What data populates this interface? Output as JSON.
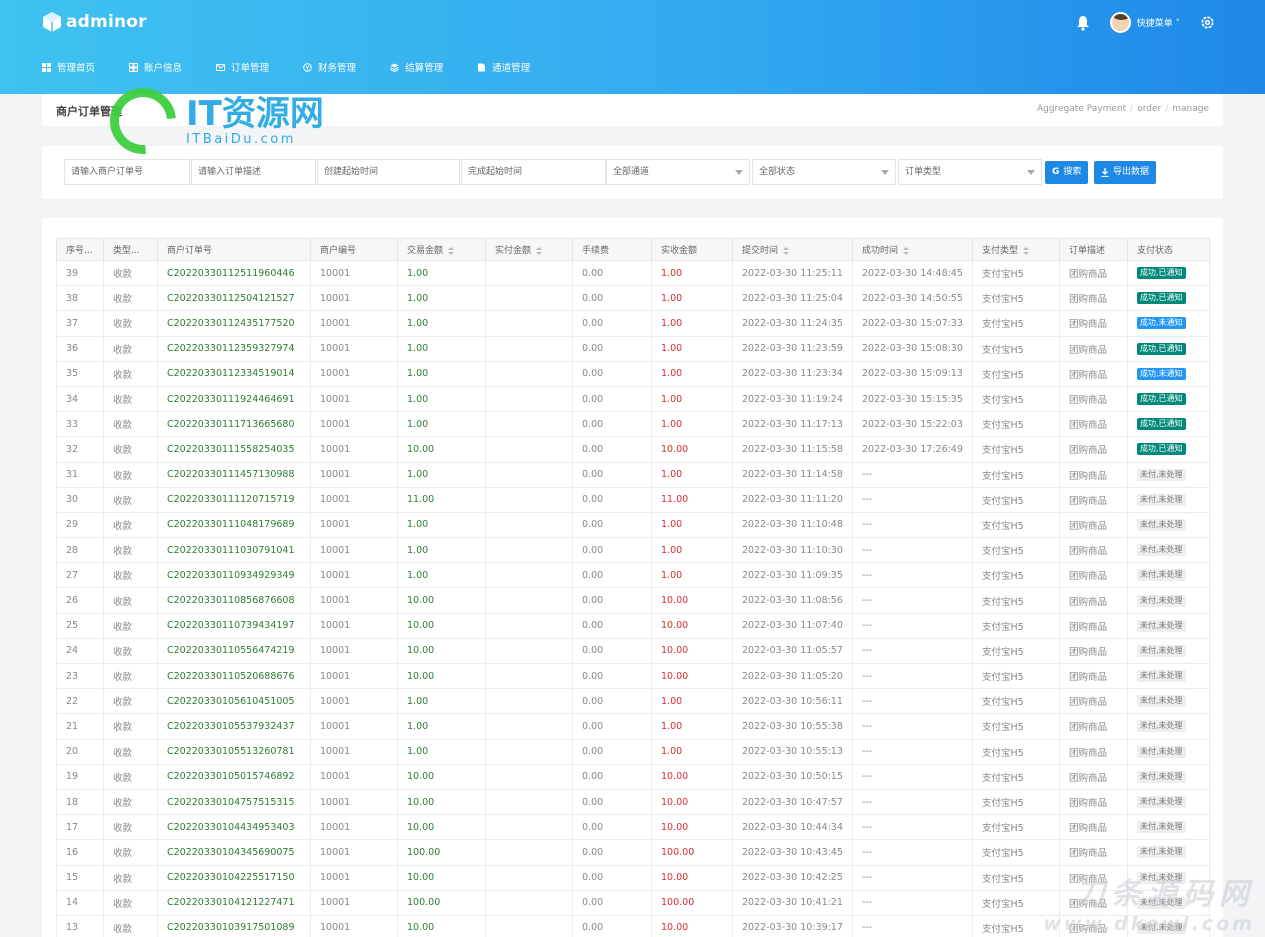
{
  "app": {
    "name": "adminor"
  },
  "header": {
    "user_label": "快捷菜单 ˅"
  },
  "nav": [
    {
      "label": "管理首页",
      "icon": "dashboard-icon"
    },
    {
      "label": "账户信息",
      "icon": "grid-icon"
    },
    {
      "label": "订单管理",
      "icon": "mail-icon"
    },
    {
      "label": "财务管理",
      "icon": "finance-icon"
    },
    {
      "label": "结算管理",
      "icon": "layers-icon"
    },
    {
      "label": "通道管理",
      "icon": "document-icon"
    }
  ],
  "page": {
    "title": "商户订单管理",
    "breadcrumb": [
      "Aggregate Payment",
      "order",
      "manage"
    ]
  },
  "filters": {
    "merchant_order_placeholder": "请输入商户订单号",
    "order_desc_placeholder": "请输入订单描述",
    "created_start_placeholder": "创建起始时间",
    "finished_start_placeholder": "完成起始时间",
    "channel_select": "全部通道",
    "status_select": "全部状态",
    "type_select": "订单类型",
    "search_button": "搜索",
    "export_button": "导出数据"
  },
  "table": {
    "columns": [
      "序号...",
      "类型...",
      "商户订单号",
      "商户编号",
      "交易金额",
      "实付金额",
      "手续费",
      "实收金额",
      "提交时间",
      "成功时间",
      "支付类型",
      "订单描述",
      "支付状态"
    ],
    "rows": [
      {
        "id": "39",
        "type": "收款",
        "order_no": "C2022033011251196044​6",
        "merchant": "10001",
        "amount": "1.00",
        "paid": "",
        "fee": "0.00",
        "received": "1.00",
        "submit_time": "2022-03-30 11:25:11",
        "success_time": "2022-03-30 14:48:45",
        "pay_type": "支付宝H5",
        "desc": "团购商品",
        "status": "成功,已通知",
        "status_kind": "ok"
      },
      {
        "id": "38",
        "type": "收款",
        "order_no": "C2022033011250412152​7",
        "merchant": "10001",
        "amount": "1.00",
        "paid": "",
        "fee": "0.00",
        "received": "1.00",
        "submit_time": "2022-03-30 11:25:04",
        "success_time": "2022-03-30 14:50:55",
        "pay_type": "支付宝H5",
        "desc": "团购商品",
        "status": "成功,已通知",
        "status_kind": "ok"
      },
      {
        "id": "37",
        "type": "收款",
        "order_no": "C202203301124351775​20",
        "merchant": "10001",
        "amount": "1.00",
        "paid": "",
        "fee": "0.00",
        "received": "1.00",
        "submit_time": "2022-03-30 11:24:35",
        "success_time": "2022-03-30 15:07:33",
        "pay_type": "支付宝H5",
        "desc": "团购商品",
        "status": "成功,未通知",
        "status_kind": "info"
      },
      {
        "id": "36",
        "type": "收款",
        "order_no": "C2022033011235932797​4",
        "merchant": "10001",
        "amount": "1.00",
        "paid": "",
        "fee": "0.00",
        "received": "1.00",
        "submit_time": "2022-03-30 11:23:59",
        "success_time": "2022-03-30 15:08:30",
        "pay_type": "支付宝H5",
        "desc": "团购商品",
        "status": "成功,已通知",
        "status_kind": "ok"
      },
      {
        "id": "35",
        "type": "收款",
        "order_no": "C2022033011233451901​4",
        "merchant": "10001",
        "amount": "1.00",
        "paid": "",
        "fee": "0.00",
        "received": "1.00",
        "submit_time": "2022-03-30 11:23:34",
        "success_time": "2022-03-30 15:09:13",
        "pay_type": "支付宝H5",
        "desc": "团购商品",
        "status": "成功,未通知",
        "status_kind": "info"
      },
      {
        "id": "34",
        "type": "收款",
        "order_no": "C2022033011192446469​1",
        "merchant": "10001",
        "amount": "1.00",
        "paid": "",
        "fee": "0.00",
        "received": "1.00",
        "submit_time": "2022-03-30 11:19:24",
        "success_time": "2022-03-30 15:15:35",
        "pay_type": "支付宝H5",
        "desc": "团购商品",
        "status": "成功,已通知",
        "status_kind": "ok"
      },
      {
        "id": "33",
        "type": "收款",
        "order_no": "C2022033011171366568​0",
        "merchant": "10001",
        "amount": "1.00",
        "paid": "",
        "fee": "0.00",
        "received": "1.00",
        "submit_time": "2022-03-30 11:17:13",
        "success_time": "2022-03-30 15:22:03",
        "pay_type": "支付宝H5",
        "desc": "团购商品",
        "status": "成功,已通知",
        "status_kind": "ok"
      },
      {
        "id": "32",
        "type": "收款",
        "order_no": "C2022033011155825403​5",
        "merchant": "10001",
        "amount": "10.00",
        "paid": "",
        "fee": "0.00",
        "received": "10.00",
        "submit_time": "2022-03-30 11:15:58",
        "success_time": "2022-03-30 17:26:49",
        "pay_type": "支付宝H5",
        "desc": "团购商品",
        "status": "成功,已通知",
        "status_kind": "ok"
      },
      {
        "id": "31",
        "type": "收款",
        "order_no": "C2022033011145713098​8",
        "merchant": "10001",
        "amount": "1.00",
        "paid": "",
        "fee": "0.00",
        "received": "1.00",
        "submit_time": "2022-03-30 11:14:58",
        "success_time": "---",
        "pay_type": "支付宝H5",
        "desc": "团购商品",
        "status": "未付,未处理",
        "status_kind": "pend"
      },
      {
        "id": "30",
        "type": "收款",
        "order_no": "C2022033011112071571​9",
        "merchant": "10001",
        "amount": "11.00",
        "paid": "",
        "fee": "0.00",
        "received": "11.00",
        "submit_time": "2022-03-30 11:11:20",
        "success_time": "---",
        "pay_type": "支付宝H5",
        "desc": "团购商品",
        "status": "未付,未处理",
        "status_kind": "pend"
      },
      {
        "id": "29",
        "type": "收款",
        "order_no": "C2022033011104817968​9",
        "merchant": "10001",
        "amount": "1.00",
        "paid": "",
        "fee": "0.00",
        "received": "1.00",
        "submit_time": "2022-03-30 11:10:48",
        "success_time": "---",
        "pay_type": "支付宝H5",
        "desc": "团购商品",
        "status": "未付,未处理",
        "status_kind": "pend"
      },
      {
        "id": "28",
        "type": "收款",
        "order_no": "C2022033011103079104​1",
        "merchant": "10001",
        "amount": "1.00",
        "paid": "",
        "fee": "0.00",
        "received": "1.00",
        "submit_time": "2022-03-30 11:10:30",
        "success_time": "---",
        "pay_type": "支付宝H5",
        "desc": "团购商品",
        "status": "未付,未处理",
        "status_kind": "pend"
      },
      {
        "id": "27",
        "type": "收款",
        "order_no": "C2022033011093492934​9",
        "merchant": "10001",
        "amount": "1.00",
        "paid": "",
        "fee": "0.00",
        "received": "1.00",
        "submit_time": "2022-03-30 11:09:35",
        "success_time": "---",
        "pay_type": "支付宝H5",
        "desc": "团购商品",
        "status": "未付,未处理",
        "status_kind": "pend"
      },
      {
        "id": "26",
        "type": "收款",
        "order_no": "C2022033011085687660​8",
        "merchant": "10001",
        "amount": "10.00",
        "paid": "",
        "fee": "0.00",
        "received": "10.00",
        "submit_time": "2022-03-30 11:08:56",
        "success_time": "---",
        "pay_type": "支付宝H5",
        "desc": "团购商品",
        "status": "未付,未处理",
        "status_kind": "pend"
      },
      {
        "id": "25",
        "type": "收款",
        "order_no": "C2022033011073943419​7",
        "merchant": "10001",
        "amount": "10.00",
        "paid": "",
        "fee": "0.00",
        "received": "10.00",
        "submit_time": "2022-03-30 11:07:40",
        "success_time": "---",
        "pay_type": "支付宝H5",
        "desc": "团购商品",
        "status": "未付,未处理",
        "status_kind": "pend"
      },
      {
        "id": "24",
        "type": "收款",
        "order_no": "C2022033011055647421​9",
        "merchant": "10001",
        "amount": "10.00",
        "paid": "",
        "fee": "0.00",
        "received": "10.00",
        "submit_time": "2022-03-30 11:05:57",
        "success_time": "---",
        "pay_type": "支付宝H5",
        "desc": "团购商品",
        "status": "未付,未处理",
        "status_kind": "pend"
      },
      {
        "id": "23",
        "type": "收款",
        "order_no": "C2022033011052068867​6",
        "merchant": "10001",
        "amount": "10.00",
        "paid": "",
        "fee": "0.00",
        "received": "10.00",
        "submit_time": "2022-03-30 11:05:20",
        "success_time": "---",
        "pay_type": "支付宝H5",
        "desc": "团购商品",
        "status": "未付,未处理",
        "status_kind": "pend"
      },
      {
        "id": "22",
        "type": "收款",
        "order_no": "C2022033010561045100​5",
        "merchant": "10001",
        "amount": "1.00",
        "paid": "",
        "fee": "0.00",
        "received": "1.00",
        "submit_time": "2022-03-30 10:56:11",
        "success_time": "---",
        "pay_type": "支付宝H5",
        "desc": "团购商品",
        "status": "未付,未处理",
        "status_kind": "pend"
      },
      {
        "id": "21",
        "type": "收款",
        "order_no": "C2022033010553793243​7",
        "merchant": "10001",
        "amount": "1.00",
        "paid": "",
        "fee": "0.00",
        "received": "1.00",
        "submit_time": "2022-03-30 10:55:38",
        "success_time": "---",
        "pay_type": "支付宝H5",
        "desc": "团购商品",
        "status": "未付,未处理",
        "status_kind": "pend"
      },
      {
        "id": "20",
        "type": "收款",
        "order_no": "C2022033010551326078​1",
        "merchant": "10001",
        "amount": "1.00",
        "paid": "",
        "fee": "0.00",
        "received": "1.00",
        "submit_time": "2022-03-30 10:55:13",
        "success_time": "---",
        "pay_type": "支付宝H5",
        "desc": "团购商品",
        "status": "未付,未处理",
        "status_kind": "pend"
      },
      {
        "id": "19",
        "type": "收款",
        "order_no": "C2022033010501574689​2",
        "merchant": "10001",
        "amount": "10.00",
        "paid": "",
        "fee": "0.00",
        "received": "10.00",
        "submit_time": "2022-03-30 10:50:15",
        "success_time": "---",
        "pay_type": "支付宝H5",
        "desc": "团购商品",
        "status": "未付,未处理",
        "status_kind": "pend"
      },
      {
        "id": "18",
        "type": "收款",
        "order_no": "C2022033010475751531​5",
        "merchant": "10001",
        "amount": "10.00",
        "paid": "",
        "fee": "0.00",
        "received": "10.00",
        "submit_time": "2022-03-30 10:47:57",
        "success_time": "---",
        "pay_type": "支付宝H5",
        "desc": "团购商品",
        "status": "未付,未处理",
        "status_kind": "pend"
      },
      {
        "id": "17",
        "type": "收款",
        "order_no": "C2022033010443495340​3",
        "merchant": "10001",
        "amount": "10.00",
        "paid": "",
        "fee": "0.00",
        "received": "10.00",
        "submit_time": "2022-03-30 10:44:34",
        "success_time": "---",
        "pay_type": "支付宝H5",
        "desc": "团购商品",
        "status": "未付,未处理",
        "status_kind": "pend"
      },
      {
        "id": "16",
        "type": "收款",
        "order_no": "C2022033010434569007​5",
        "merchant": "10001",
        "amount": "100.00",
        "paid": "",
        "fee": "0.00",
        "received": "100.00",
        "submit_time": "2022-03-30 10:43:45",
        "success_time": "---",
        "pay_type": "支付宝H5",
        "desc": "团购商品",
        "status": "未付,未处理",
        "status_kind": "pend"
      },
      {
        "id": "15",
        "type": "收款",
        "order_no": "C2022033010422551715​0",
        "merchant": "10001",
        "amount": "10.00",
        "paid": "",
        "fee": "0.00",
        "received": "10.00",
        "submit_time": "2022-03-30 10:42:25",
        "success_time": "---",
        "pay_type": "支付宝H5",
        "desc": "团购商品",
        "status": "未付,未处理",
        "status_kind": "pend"
      },
      {
        "id": "14",
        "type": "收款",
        "order_no": "C2022033010412122747​1",
        "merchant": "10001",
        "amount": "100.00",
        "paid": "",
        "fee": "0.00",
        "received": "100.00",
        "submit_time": "2022-03-30 10:41:21",
        "success_time": "---",
        "pay_type": "支付宝H5",
        "desc": "团购商品",
        "status": "未付,未处理",
        "status_kind": "pend"
      },
      {
        "id": "13",
        "type": "收款",
        "order_no": "C2022033010391750108​9",
        "merchant": "10001",
        "amount": "10.00",
        "paid": "",
        "fee": "0.00",
        "received": "10.00",
        "submit_time": "2022-03-30 10:39:17",
        "success_time": "---",
        "pay_type": "支付宝H5",
        "desc": "团购商品",
        "status": "未付,未处理",
        "status_kind": "pend"
      }
    ]
  },
  "watermarks": {
    "main_title": "IT资源网",
    "main_sub": "ITBaiDu.com",
    "corner_title": "刀条源码网",
    "corner_sub": "www.dkewl.com"
  },
  "colors": {
    "header_start": "#3fc2f0",
    "header_end": "#1e88e8",
    "accent": "#1e88e5",
    "ok": "#00897b",
    "info": "#2196f3",
    "amount": "#2e7d32",
    "received": "#d32f2f"
  }
}
